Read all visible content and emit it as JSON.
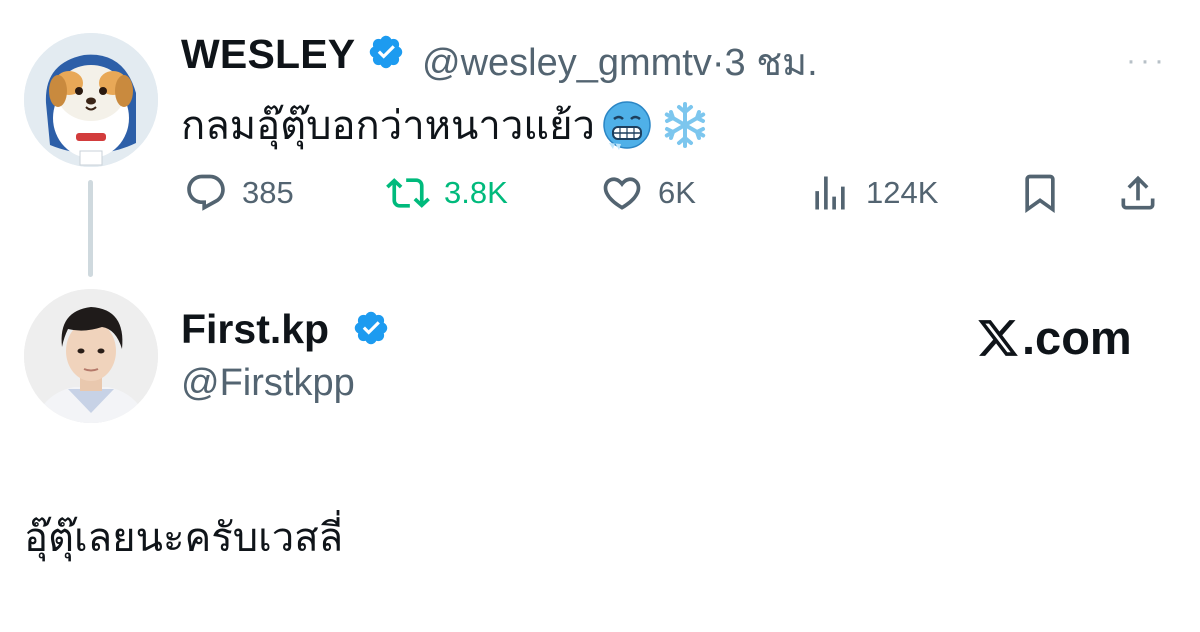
{
  "tweet": {
    "author_name": "WESLEY",
    "handle": "@wesley_gmmtv",
    "separator": "·",
    "time": "3 ชม.",
    "text": "กลมอุ๊ตุ๊บอกว่าหนาวแย้ว",
    "emojis": [
      "cold-face-icon",
      "snowflake-icon"
    ],
    "more_label": "···",
    "stats": {
      "replies": "385",
      "retweets": "3.8K",
      "likes": "6K",
      "views": "124K"
    }
  },
  "reply": {
    "author_name": "First.kp",
    "handle": "@Firstkpp",
    "text": "อุ๊ตุ๊เลยนะครับเวสลี่"
  },
  "branding": {
    "logo_text": ".com"
  },
  "colors": {
    "verified": "#1d9bf0",
    "retweet": "#00ba7c",
    "secondary_text": "#536471"
  }
}
